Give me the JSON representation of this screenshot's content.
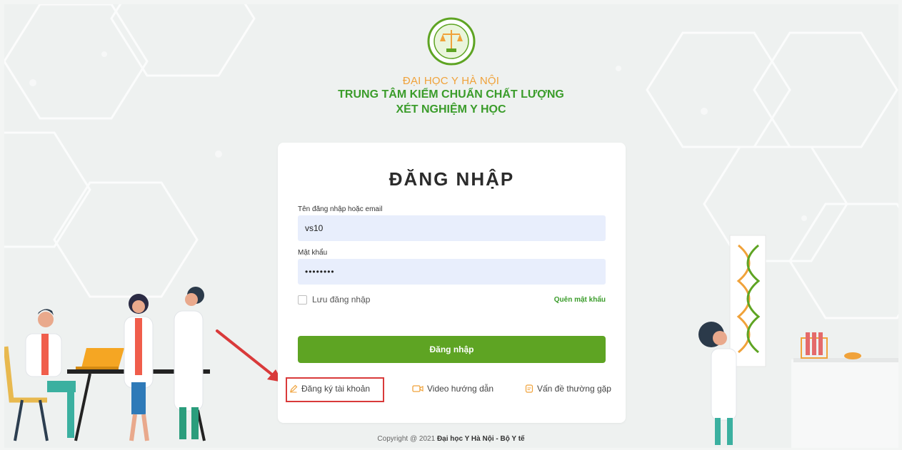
{
  "header": {
    "university": "ĐẠI HỌC Y HÀ NỘI",
    "center_line1": "TRUNG TÂM KIỂM CHUẨN CHẤT LƯỢNG",
    "center_line2": "XÉT NGHIỆM Y HỌC"
  },
  "login": {
    "title": "ĐĂNG NHẬP",
    "username_label": "Tên đăng nhập hoặc email",
    "username_value": "vs10",
    "password_label": "Mật khẩu",
    "password_value": "••••••••",
    "remember_label": "Lưu đăng nhập",
    "forgot_label": "Quên mật khẩu",
    "submit_label": "Đăng nhập"
  },
  "links": {
    "register": "Đăng ký tài khoản",
    "video": "Video hướng dẫn",
    "faq": "Vấn đề thường gặp"
  },
  "footer": {
    "prefix": "Copyright @ 2021",
    "owner": "Đại học Y Hà Nội - Bộ Y tế"
  },
  "colors": {
    "accent_green": "#5ea423",
    "brand_orange": "#f0a23a",
    "annotation_red": "#d93a3a"
  }
}
